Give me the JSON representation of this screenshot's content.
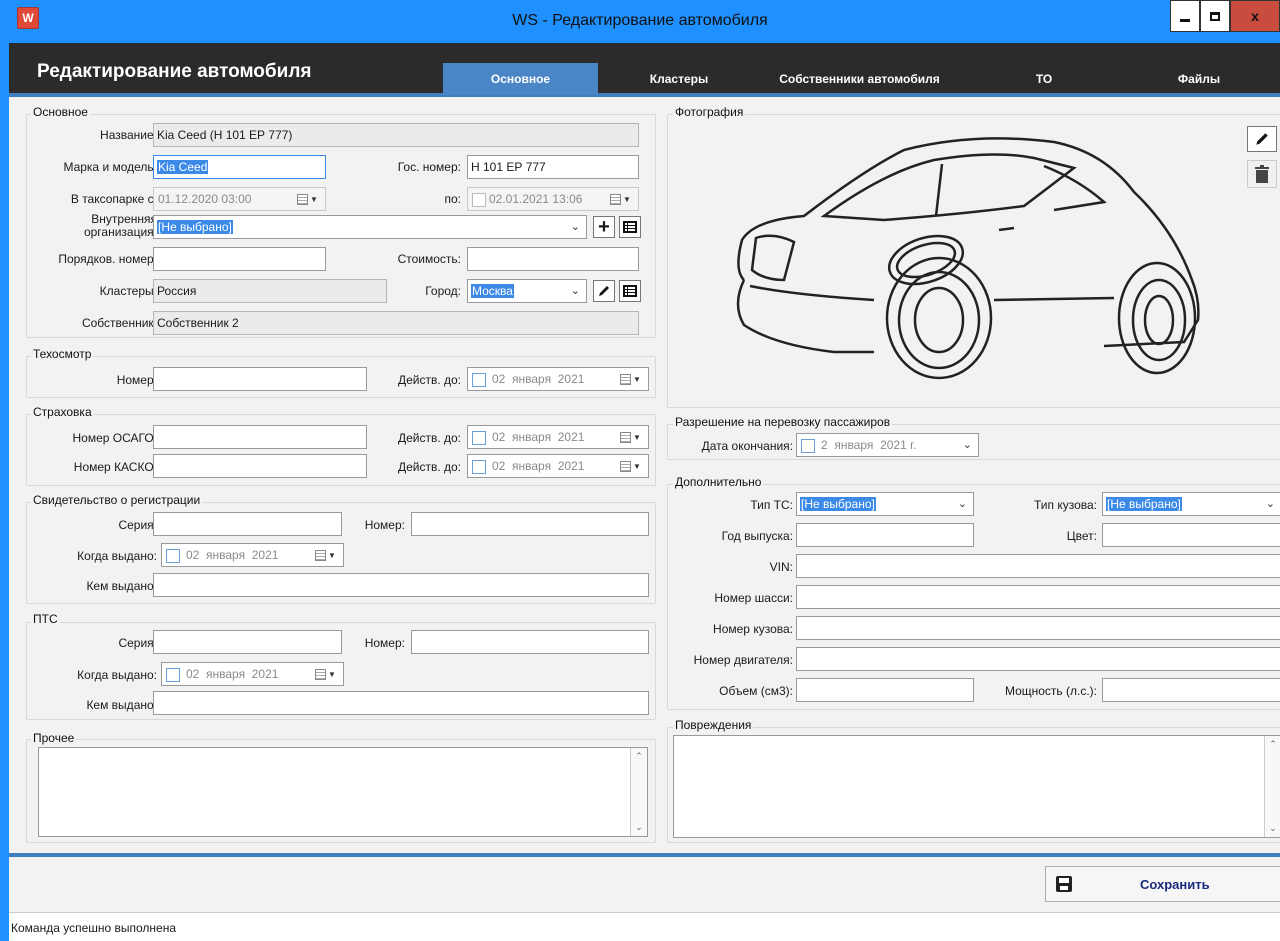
{
  "window": {
    "title": "WS - Редактирование автомобиля",
    "icon_letter": "W"
  },
  "header": {
    "title": "Редактирование автомобиля",
    "tabs": [
      "Основное",
      "Кластеры",
      "Собственники автомобиля",
      "ТО",
      "Файлы"
    ],
    "active_tab": "Основное"
  },
  "basic": {
    "group_title": "Основное",
    "name_label": "Название:",
    "name_value": "Kia Ceed (Н 101 ЕР 777)",
    "brand_label": "Марка и модель:",
    "brand_value": "Kia Ceed",
    "plate_label": "Гос. номер:",
    "plate_value": "Н 101 ЕР 777",
    "taxi_from_label": "В таксопарке с:",
    "taxi_from_value": "01.12.2020 03:00",
    "taxi_to_label": "по:",
    "taxi_to_value": "02.01.2021 13:06",
    "org_label_1": "Внутренняя",
    "org_label_2": "организация:",
    "org_value": "[Не выбрано]",
    "order_label": "Порядков. номер:",
    "order_value": "",
    "cost_label": "Стоимость:",
    "cost_value": "",
    "clusters_label": "Кластеры:",
    "clusters_value": "Россия",
    "city_label": "Город:",
    "city_value": "Москва",
    "owner_label": "Собственник:",
    "owner_value": "Собственник 2"
  },
  "inspection": {
    "group_title": "Техосмотр",
    "number_label": "Номер:",
    "number_value": "",
    "valid_label": "Действ. до:",
    "valid_date": "02  января  2021"
  },
  "insurance": {
    "group_title": "Страховка",
    "osago_label": "Номер ОСАГО:",
    "osago_value": "",
    "osago_valid_label": "Действ. до:",
    "osago_valid_date": "02  января  2021",
    "kasko_label": "Номер КАСКО:",
    "kasko_value": "",
    "kasko_valid_label": "Действ. до:",
    "kasko_valid_date": "02  января  2021"
  },
  "registration": {
    "group_title": "Свидетельство о регистрации",
    "series_label": "Серия:",
    "number_label": "Номер:",
    "issued_when_label": "Когда выдано:",
    "issued_when_date": "02  января  2021",
    "issued_by_label": "Кем выдано:"
  },
  "pts": {
    "group_title": "ПТС",
    "series_label": "Серия:",
    "number_label": "Номер:",
    "issued_when_label": "Когда выдано:",
    "issued_when_date": "02  января  2021",
    "issued_by_label": "Кем выдано:"
  },
  "other": {
    "group_title": "Прочее",
    "value": ""
  },
  "photo": {
    "group_title": "Фотография",
    "edit_icon": "pencil-icon",
    "delete_icon": "trash-icon"
  },
  "permit": {
    "group_title": "Разрешение на перевозку пассажиров",
    "end_label": "Дата окончания:",
    "end_date": "2  января  2021 г."
  },
  "additional": {
    "group_title": "Дополнительно",
    "ts_type_label": "Тип ТС:",
    "ts_type_value": "[Не выбрано]",
    "body_type_label": "Тип кузова:",
    "body_type_value": "[Не выбрано]",
    "year_label": "Год выпуска:",
    "color_label": "Цвет:",
    "vin_label": "VIN:",
    "chassis_label": "Номер шасси:",
    "body_number_label": "Номер кузова:",
    "engine_label": "Номер двигателя:",
    "volume_label": "Объем (см3):",
    "power_label": "Мощность (л.с.):"
  },
  "damage": {
    "group_title": "Повреждения",
    "value": ""
  },
  "footer": {
    "save_label": "Сохранить",
    "save_icon": "floppy-icon"
  },
  "status": {
    "text": "Команда успешно выполнена"
  }
}
